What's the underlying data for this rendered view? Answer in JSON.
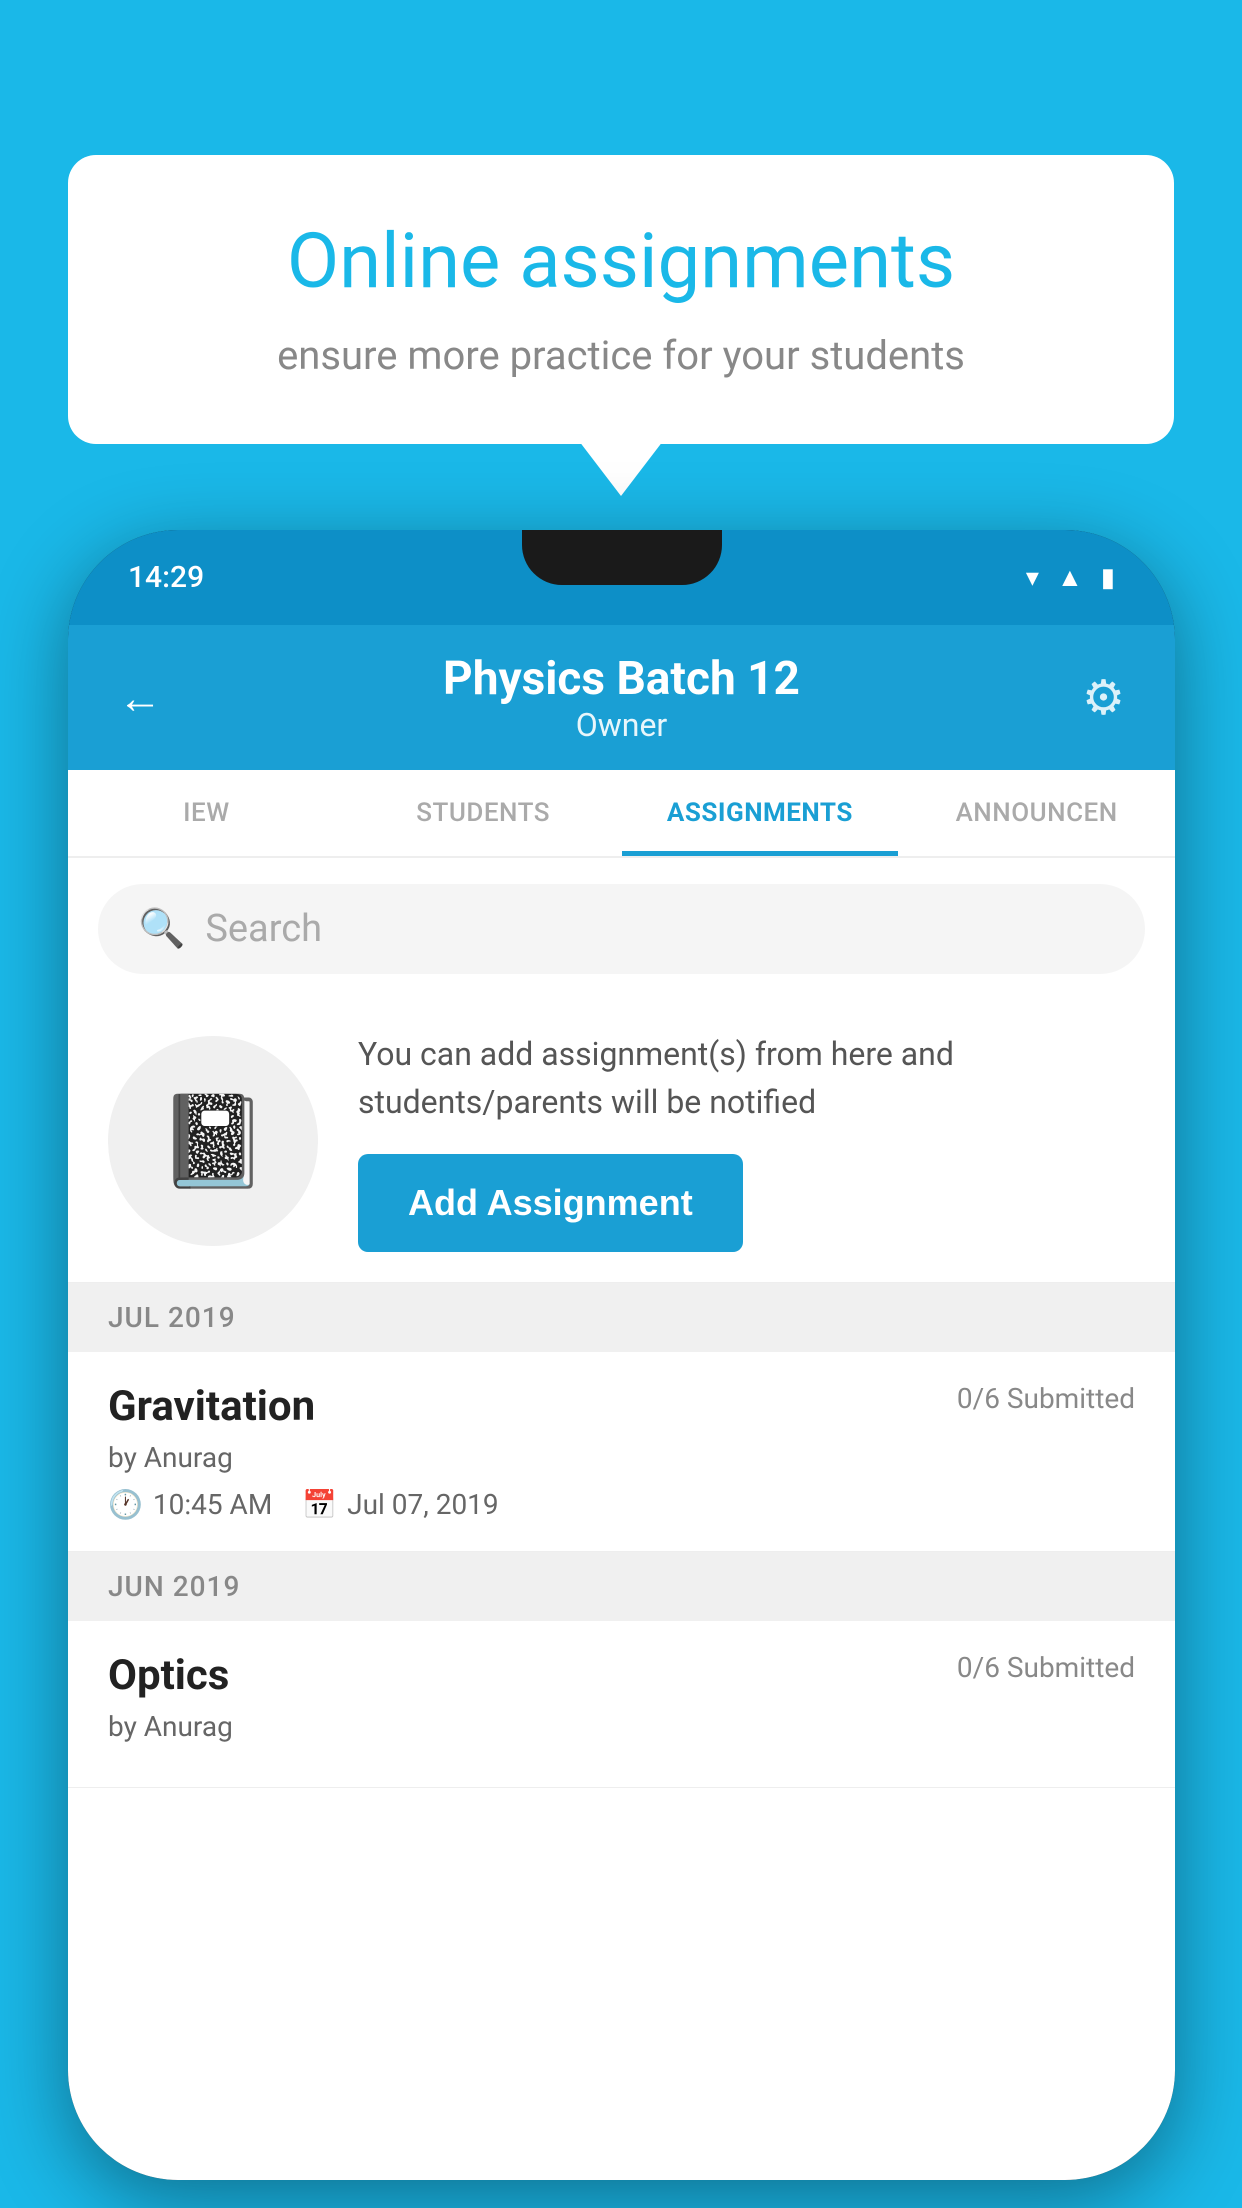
{
  "background_color": "#1ab8e8",
  "speech_bubble": {
    "title": "Online assignments",
    "subtitle": "ensure more practice for your students"
  },
  "phone": {
    "status_bar": {
      "time": "14:29",
      "icons": [
        "wifi",
        "signal",
        "battery"
      ]
    },
    "header": {
      "title": "Physics Batch 12",
      "subtitle": "Owner",
      "back_label": "←",
      "gear_label": "⚙"
    },
    "tabs": [
      {
        "label": "IEW",
        "active": false
      },
      {
        "label": "STUDENTS",
        "active": false
      },
      {
        "label": "ASSIGNMENTS",
        "active": true
      },
      {
        "label": "ANNOUNCEN",
        "active": false
      }
    ],
    "search": {
      "placeholder": "Search"
    },
    "add_assignment_section": {
      "description": "You can add assignment(s) from here and students/parents will be notified",
      "button_label": "Add Assignment"
    },
    "sections": [
      {
        "header": "JUL 2019",
        "items": [
          {
            "name": "Gravitation",
            "submitted": "0/6 Submitted",
            "by": "by Anurag",
            "time": "10:45 AM",
            "date": "Jul 07, 2019"
          }
        ]
      },
      {
        "header": "JUN 2019",
        "items": [
          {
            "name": "Optics",
            "submitted": "0/6 Submitted",
            "by": "by Anurag",
            "time": "",
            "date": ""
          }
        ]
      }
    ]
  }
}
